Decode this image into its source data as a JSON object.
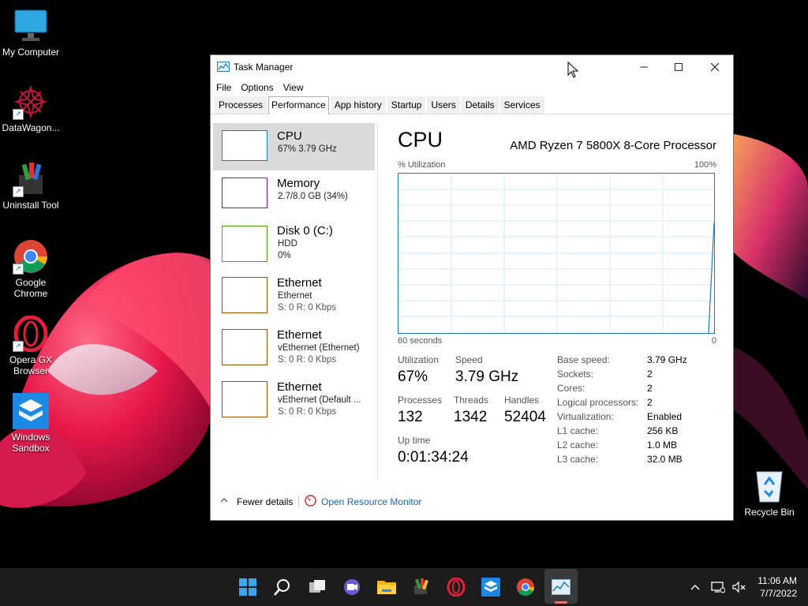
{
  "desktop": {
    "icons": [
      {
        "label": "My Computer"
      },
      {
        "label": "DataWagon..."
      },
      {
        "label": "Uninstall Tool"
      },
      {
        "label": "Google Chrome"
      },
      {
        "label": "Opera GX Browser"
      },
      {
        "label": "Windows Sandbox"
      }
    ],
    "recycle_bin": "Recycle Bin"
  },
  "window": {
    "title": "Task Manager",
    "menu": [
      "File",
      "Options",
      "View"
    ],
    "tabs": [
      "Processes",
      "Performance",
      "App history",
      "Startup",
      "Users",
      "Details",
      "Services"
    ],
    "active_tab": "Performance"
  },
  "resources": [
    {
      "name": "CPU",
      "line1": "67% 3.79 GHz",
      "line2": "",
      "color": "#1b79c2"
    },
    {
      "name": "Memory",
      "line1": "2.7/8.0 GB (34%)",
      "line2": "",
      "color": "#8b12ae"
    },
    {
      "name": "Disk 0 (C:)",
      "line1": "HDD",
      "line2": "0%",
      "color": "#4da60c"
    },
    {
      "name": "Ethernet",
      "line1": "Ethernet",
      "line2": "S: 0 R: 0 Kbps",
      "color": "#a74f01"
    },
    {
      "name": "Ethernet",
      "line1": "vEthernet (Ethernet)",
      "line2": "S: 0 R: 0 Kbps",
      "color": "#a74f01"
    },
    {
      "name": "Ethernet",
      "line1": "vEthernet (Default ...",
      "line2": "S: 0 R: 0 Kbps",
      "color": "#a74f01"
    }
  ],
  "cpu": {
    "title": "CPU",
    "model": "AMD Ryzen 7 5800X 8-Core Processor",
    "graph_label": "% Utilization",
    "graph_max": "100%",
    "time_label": "60 seconds",
    "time_min": "0",
    "utilization_label": "Utilization",
    "utilization": "67%",
    "speed_label": "Speed",
    "speed": "3.79 GHz",
    "processes_label": "Processes",
    "processes": "132",
    "threads_label": "Threads",
    "threads": "1342",
    "handles_label": "Handles",
    "handles": "52404",
    "uptime_label": "Up time",
    "uptime": "0:01:34:24",
    "details": [
      {
        "k": "Base speed:",
        "v": "3.79 GHz"
      },
      {
        "k": "Sockets:",
        "v": "2"
      },
      {
        "k": "Cores:",
        "v": "2"
      },
      {
        "k": "Logical processors:",
        "v": "2"
      },
      {
        "k": "Virtualization:",
        "v": "Enabled"
      },
      {
        "k": "L1 cache:",
        "v": "256 KB"
      },
      {
        "k": "L2 cache:",
        "v": "1.0 MB"
      },
      {
        "k": "L3 cache:",
        "v": "32.0 MB"
      }
    ]
  },
  "footer": {
    "fewer_details": "Fewer details",
    "open_monitor": "Open Resource Monitor"
  },
  "taskbar": {
    "icons": [
      "start-icon",
      "search-icon",
      "task-view-icon",
      "chat-icon",
      "file-explorer-icon",
      "datawagon-icon",
      "opera-gx-icon",
      "windows-sandbox-icon",
      "chrome-icon",
      "task-manager-icon"
    ],
    "time": "11:06 AM",
    "date": "7/7/2022"
  }
}
